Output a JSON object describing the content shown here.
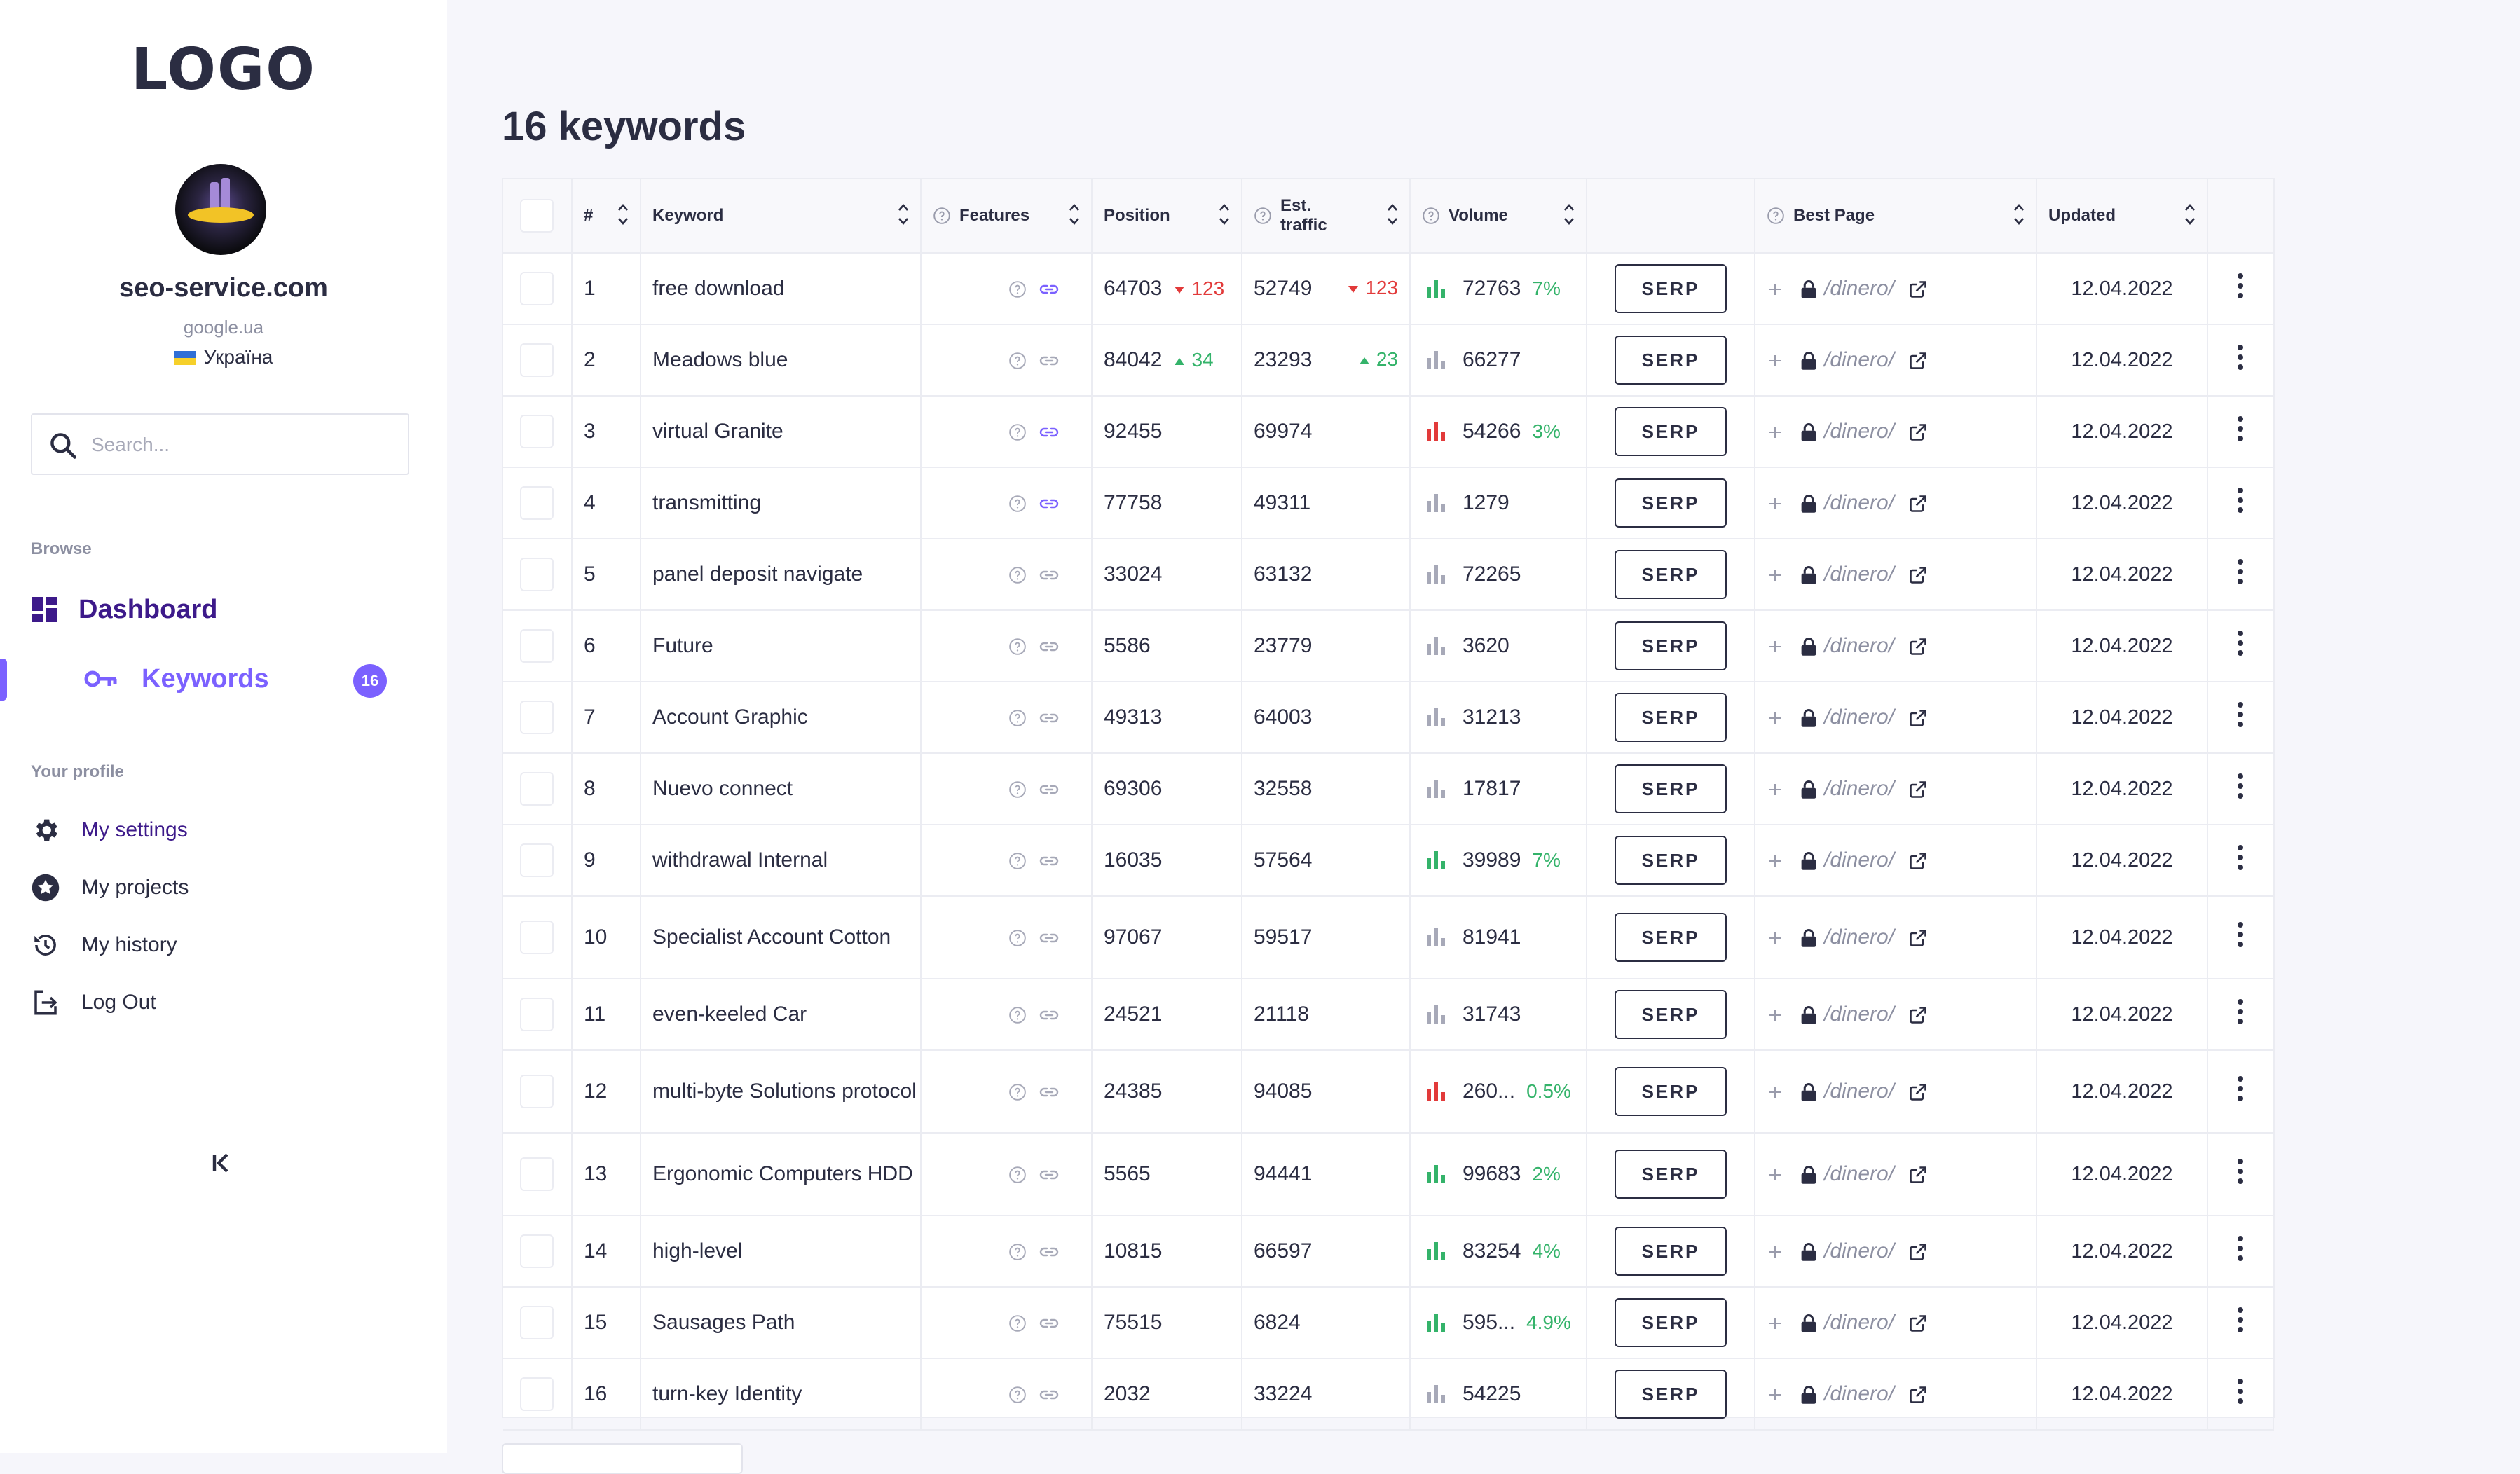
{
  "sidebar": {
    "logo": "LOGO",
    "site_name": "seo-service.com",
    "engine": "google.ua",
    "country": "Україна",
    "search_placeholder": "Search...",
    "browse_title": "Browse",
    "dashboard_label": "Dashboard",
    "keywords_label": "Keywords",
    "keywords_count": "16",
    "profile_title": "Your profile",
    "profile_items": [
      {
        "label": "My settings",
        "icon": "gear-icon"
      },
      {
        "label": "My projects",
        "icon": "star-icon"
      },
      {
        "label": "My history",
        "icon": "history-icon"
      },
      {
        "label": "Log Out",
        "icon": "logout-icon"
      }
    ]
  },
  "main": {
    "title": "16 keywords",
    "columns": {
      "num": "#",
      "keyword": "Keyword",
      "features": "Features",
      "position": "Position",
      "traffic": "Est. traffic",
      "volume": "Volume",
      "best_page": "Best Page",
      "updated": "Updated"
    },
    "serp_label": "SERP",
    "colors": {
      "accent": "#7b61ff",
      "up": "#34b36a",
      "down": "#e23a3a",
      "dark": "#2b2d42"
    },
    "rows": [
      {
        "n": "1",
        "kw": "free download",
        "pos": "64703",
        "posChg": "123",
        "posDir": "dn",
        "traf": "52749",
        "trafChg": "123",
        "trafDir": "dn",
        "vol": "72763",
        "pct": "7%",
        "bars": "green",
        "linkActive": true,
        "path": "/dinero/",
        "updated": "12.04.2022"
      },
      {
        "n": "2",
        "kw": "Meadows blue",
        "pos": "84042",
        "posChg": "34",
        "posDir": "up",
        "traf": "23293",
        "trafChg": "23",
        "trafDir": "up",
        "vol": "66277",
        "pct": "",
        "bars": "gray",
        "linkActive": false,
        "path": "/dinero/",
        "updated": "12.04.2022"
      },
      {
        "n": "3",
        "kw": "virtual Granite",
        "pos": "92455",
        "posChg": "",
        "posDir": "",
        "traf": "69974",
        "trafChg": "",
        "trafDir": "",
        "vol": "54266",
        "pct": "3%",
        "bars": "red",
        "linkActive": true,
        "path": "/dinero/",
        "updated": "12.04.2022"
      },
      {
        "n": "4",
        "kw": "transmitting",
        "pos": "77758",
        "posChg": "",
        "posDir": "",
        "traf": "49311",
        "trafChg": "",
        "trafDir": "",
        "vol": "1279",
        "pct": "",
        "bars": "gray",
        "linkActive": true,
        "path": "/dinero/",
        "updated": "12.04.2022"
      },
      {
        "n": "5",
        "kw": "panel deposit navigate",
        "pos": "33024",
        "posChg": "",
        "posDir": "",
        "traf": "63132",
        "trafChg": "",
        "trafDir": "",
        "vol": "72265",
        "pct": "",
        "bars": "gray",
        "linkActive": false,
        "path": "/dinero/",
        "updated": "12.04.2022"
      },
      {
        "n": "6",
        "kw": "Future",
        "pos": "5586",
        "posChg": "",
        "posDir": "",
        "traf": "23779",
        "trafChg": "",
        "trafDir": "",
        "vol": "3620",
        "pct": "",
        "bars": "gray",
        "linkActive": false,
        "path": "/dinero/",
        "updated": "12.04.2022"
      },
      {
        "n": "7",
        "kw": "Account Graphic",
        "pos": "49313",
        "posChg": "",
        "posDir": "",
        "traf": "64003",
        "trafChg": "",
        "trafDir": "",
        "vol": "31213",
        "pct": "",
        "bars": "gray",
        "linkActive": false,
        "path": "/dinero/",
        "updated": "12.04.2022"
      },
      {
        "n": "8",
        "kw": "Nuevo connect",
        "pos": "69306",
        "posChg": "",
        "posDir": "",
        "traf": "32558",
        "trafChg": "",
        "trafDir": "",
        "vol": "17817",
        "pct": "",
        "bars": "gray",
        "linkActive": false,
        "path": "/dinero/",
        "updated": "12.04.2022"
      },
      {
        "n": "9",
        "kw": "withdrawal Internal",
        "pos": "16035",
        "posChg": "",
        "posDir": "",
        "traf": "57564",
        "trafChg": "",
        "trafDir": "",
        "vol": "39989",
        "pct": "7%",
        "bars": "green",
        "linkActive": false,
        "path": "/dinero/",
        "updated": "12.04.2022"
      },
      {
        "n": "10",
        "kw": "Specialist Account Cotton",
        "pos": "97067",
        "posChg": "",
        "posDir": "",
        "traf": "59517",
        "trafChg": "",
        "trafDir": "",
        "vol": "81941",
        "pct": "",
        "bars": "gray",
        "linkActive": false,
        "path": "/dinero/",
        "updated": "12.04.2022"
      },
      {
        "n": "11",
        "kw": "even-keeled Car",
        "pos": "24521",
        "posChg": "",
        "posDir": "",
        "traf": "21118",
        "trafChg": "",
        "trafDir": "",
        "vol": "31743",
        "pct": "",
        "bars": "gray",
        "linkActive": false,
        "path": "/dinero/",
        "updated": "12.04.2022"
      },
      {
        "n": "12",
        "kw": "multi-byte Solutions protocol",
        "pos": "24385",
        "posChg": "",
        "posDir": "",
        "traf": "94085",
        "trafChg": "",
        "trafDir": "",
        "vol": "260...",
        "pct": "0.5%",
        "bars": "red",
        "linkActive": false,
        "path": "/dinero/",
        "updated": "12.04.2022"
      },
      {
        "n": "13",
        "kw": "Ergonomic Computers HDD",
        "pos": "5565",
        "posChg": "",
        "posDir": "",
        "traf": "94441",
        "trafChg": "",
        "trafDir": "",
        "vol": "99683",
        "pct": "2%",
        "bars": "green",
        "linkActive": false,
        "path": "/dinero/",
        "updated": "12.04.2022"
      },
      {
        "n": "14",
        "kw": "high-level",
        "pos": "10815",
        "posChg": "",
        "posDir": "",
        "traf": "66597",
        "trafChg": "",
        "trafDir": "",
        "vol": "83254",
        "pct": "4%",
        "bars": "green",
        "linkActive": false,
        "path": "/dinero/",
        "updated": "12.04.2022"
      },
      {
        "n": "15",
        "kw": "Sausages Path",
        "pos": "75515",
        "posChg": "",
        "posDir": "",
        "traf": "6824",
        "trafChg": "",
        "trafDir": "",
        "vol": "595...",
        "pct": "4.9%",
        "bars": "green",
        "linkActive": false,
        "path": "/dinero/",
        "updated": "12.04.2022"
      },
      {
        "n": "16",
        "kw": "turn-key Identity",
        "pos": "2032",
        "posChg": "",
        "posDir": "",
        "traf": "33224",
        "trafChg": "",
        "trafDir": "",
        "vol": "54225",
        "pct": "",
        "bars": "gray",
        "linkActive": false,
        "path": "/dinero/",
        "updated": "12.04.2022"
      }
    ]
  }
}
